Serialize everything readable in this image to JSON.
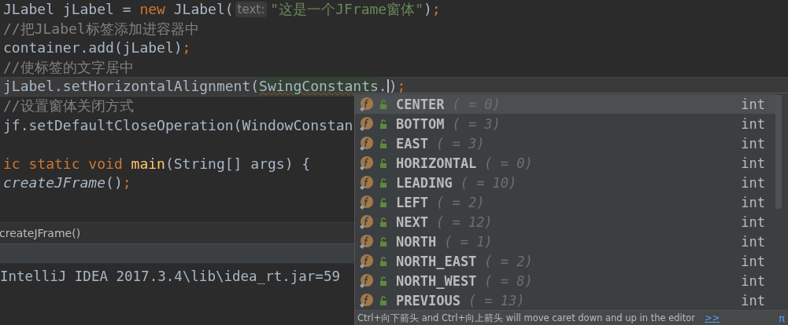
{
  "editor": {
    "lines": [
      {
        "current": false,
        "tokens": [
          {
            "kind": "plain",
            "text": "JLabel jLabel = "
          },
          {
            "kind": "keyword",
            "text": "new"
          },
          {
            "kind": "plain",
            "text": " JLabel("
          },
          {
            "kind": "hint",
            "text": "text:"
          },
          {
            "kind": "string",
            "text": "\"这是一个JFrame窗体\""
          },
          {
            "kind": "plain",
            "text": ")"
          },
          {
            "kind": "punct",
            "text": ";"
          }
        ]
      },
      {
        "current": false,
        "tokens": [
          {
            "kind": "comment",
            "text": "//把JLabel标签添加进容器中"
          }
        ]
      },
      {
        "current": false,
        "tokens": [
          {
            "kind": "plain",
            "text": "container.add(jLabel)"
          },
          {
            "kind": "punct",
            "text": ";"
          }
        ]
      },
      {
        "current": false,
        "tokens": [
          {
            "kind": "comment",
            "text": "//使标签的文字居中"
          }
        ]
      },
      {
        "current": true,
        "tokens": [
          {
            "kind": "plain",
            "text": "jLabel.setHorizontalAlignment("
          },
          {
            "kind": "error",
            "text": "SwingConstants"
          },
          {
            "kind": "plain",
            "text": "."
          },
          {
            "kind": "caret"
          },
          {
            "kind": "plain",
            "text": ")"
          },
          {
            "kind": "punct",
            "text": ";"
          }
        ]
      },
      {
        "current": false,
        "tokens": [
          {
            "kind": "comment",
            "text": "//设置窗体关闭方式"
          }
        ]
      },
      {
        "current": false,
        "tokens": [
          {
            "kind": "plain",
            "text": "jf.setDefaultCloseOperation(WindowConstan"
          }
        ]
      },
      {
        "current": false
      },
      {
        "current": false,
        "tokens": [
          {
            "kind": "keyword",
            "text": "ic static void "
          },
          {
            "kind": "method",
            "text": "main"
          },
          {
            "kind": "plain",
            "text": "(String[] args) {"
          }
        ]
      },
      {
        "current": false,
        "tokens": [
          {
            "kind": "static-call",
            "text": "createJFrame"
          },
          {
            "kind": "plain",
            "text": "()"
          },
          {
            "kind": "punct",
            "text": ";"
          }
        ]
      }
    ]
  },
  "breadcrumb": "createJFrame()",
  "console": {
    "line": "IntelliJ IDEA 2017.3.4\\lib\\idea_rt.jar=59"
  },
  "completion": {
    "items": [
      {
        "name": "CENTER",
        "value": "( = 0)",
        "type": "int",
        "selected": true
      },
      {
        "name": "BOTTOM",
        "value": "( = 3)",
        "type": "int",
        "selected": false
      },
      {
        "name": "EAST",
        "value": "( = 3)",
        "type": "int",
        "selected": false
      },
      {
        "name": "HORIZONTAL",
        "value": "( = 0)",
        "type": "int",
        "selected": false
      },
      {
        "name": "LEADING",
        "value": "( = 10)",
        "type": "int",
        "selected": false
      },
      {
        "name": "LEFT",
        "value": "( = 2)",
        "type": "int",
        "selected": false
      },
      {
        "name": "NEXT",
        "value": "( = 12)",
        "type": "int",
        "selected": false
      },
      {
        "name": "NORTH",
        "value": "( = 1)",
        "type": "int",
        "selected": false
      },
      {
        "name": "NORTH_EAST",
        "value": "( = 2)",
        "type": "int",
        "selected": false
      },
      {
        "name": "NORTH_WEST",
        "value": "( = 8)",
        "type": "int",
        "selected": false
      },
      {
        "name": "PREVIOUS",
        "value": "( = 13)",
        "type": "int",
        "selected": false
      }
    ],
    "hint": "Ctrl+向下箭头 and Ctrl+向上箭头 will move caret down and up in the editor",
    "hint_link": ">>",
    "pi_button": "π"
  }
}
